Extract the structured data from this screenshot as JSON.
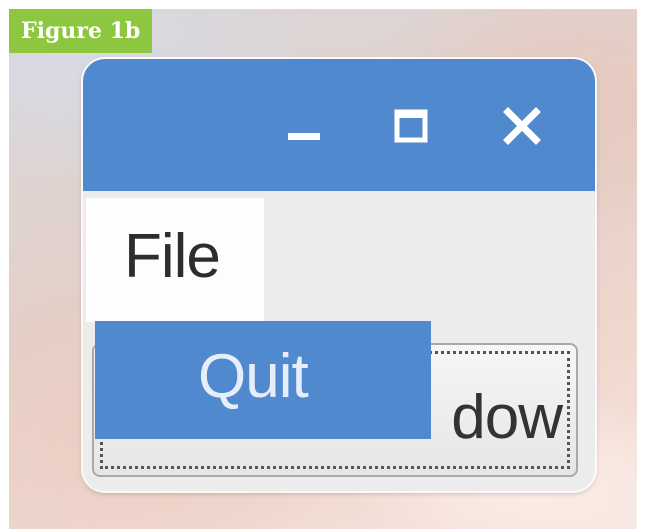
{
  "figure": {
    "label": "Figure 1b",
    "label_color": "#8dc63f"
  },
  "window": {
    "titlebar_color": "#5189cf",
    "controls": {
      "minimize_icon": "minimize-icon",
      "maximize_icon": "maximize-icon",
      "close_icon": "close-icon"
    }
  },
  "menubar": {
    "file_label": "File"
  },
  "file_menu": {
    "items": [
      {
        "label": "Quit",
        "highlighted": true
      }
    ],
    "highlight_color": "#5189cf"
  },
  "content": {
    "button_label_visible": "dow"
  }
}
